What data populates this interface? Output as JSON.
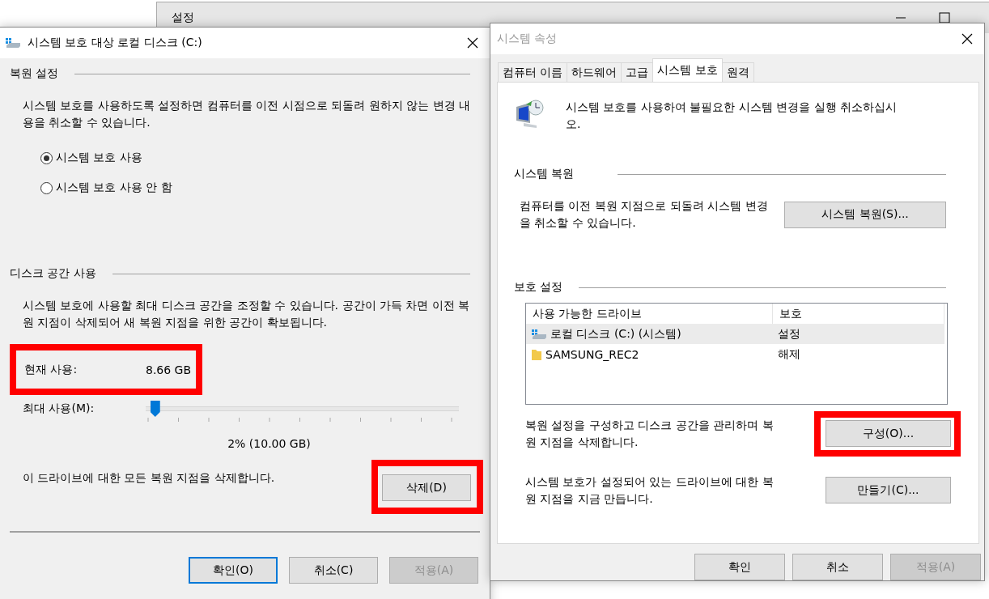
{
  "background_window": {
    "title": "설정"
  },
  "restore_dialog": {
    "title": "시스템 보호 대상 로컬 디스크 (C:)",
    "restore_settings": {
      "heading": "복원 설정",
      "text": "시스템 보호를 사용하도록 설정하면 컴퓨터를 이전 시점으로 되돌려 원하지 않는 변경 내용을 취소할 수 있습니다.",
      "options": [
        {
          "label": "시스템 보호 사용",
          "selected": true
        },
        {
          "label": "시스템 보호 사용 안 함",
          "selected": false
        }
      ]
    },
    "disk_usage": {
      "heading": "디스크 공간 사용",
      "text": "시스템 보호에 사용할 최대 디스크 공간을 조정할 수 있습니다. 공간이 가득 차면 이전 복원 지점이 삭제되어 새 복원 지점을 위한 공간이 확보됩니다.",
      "current": {
        "label": "현재 사용:",
        "value": "8.66 GB",
        "highlighted": true
      },
      "max": {
        "label": "최대 사용(M):",
        "level": 0.02,
        "reading": "2% (10.00 GB)"
      },
      "delete": {
        "text": "이 드라이브에 대한 모든 복원 지점을 삭제합니다.",
        "button": "삭제(D)",
        "highlighted": true
      }
    },
    "buttons": [
      {
        "label": "확인(O)",
        "default": true,
        "disabled": false
      },
      {
        "label": "취소(C)",
        "default": false,
        "disabled": false
      },
      {
        "label": "적용(A)",
        "default": false,
        "disabled": true
      }
    ]
  },
  "system_properties": {
    "title": "시스템 속성",
    "tabs": [
      {
        "label": "컴퓨터 이름",
        "selected": false
      },
      {
        "label": "하드웨어",
        "selected": false
      },
      {
        "label": "고급",
        "selected": false
      },
      {
        "label": "시스템 보호",
        "selected": true
      },
      {
        "label": "원격",
        "selected": false
      }
    ],
    "intro": "시스템 보호를 사용하여 불필요한 시스템 변경을 실행 취소하십시오.",
    "system_restore": {
      "heading": "시스템 복원",
      "text": "컴퓨터를 이전 복원 지점으로 되돌려 시스템 변경을 취소할 수 있습니다.",
      "button": "시스템 복원(S)..."
    },
    "protection": {
      "heading": "보호 설정",
      "columns": [
        "사용 가능한 드라이브",
        "보호"
      ],
      "drives": [
        {
          "name": "로컬 디스크 (C:) (시스템)",
          "protection": "설정",
          "kind": "system",
          "selected": true
        },
        {
          "name": "SAMSUNG_REC2",
          "protection": "해제",
          "kind": "folder",
          "selected": false
        }
      ],
      "actions": [
        {
          "text": "복원 설정을 구성하고 디스크 공간을 관리하며 복원 지점을 삭제합니다.",
          "button": "구성(O)...",
          "highlighted": true
        },
        {
          "text": "시스템 보호가 설정되어 있는 드라이브에 대한 복원 지점을 지금 만듭니다.",
          "button": "만들기(C)...",
          "highlighted": false
        }
      ]
    },
    "buttons": [
      {
        "label": "확인",
        "disabled": false
      },
      {
        "label": "취소",
        "disabled": false
      },
      {
        "label": "적용(A)",
        "disabled": true
      }
    ]
  }
}
